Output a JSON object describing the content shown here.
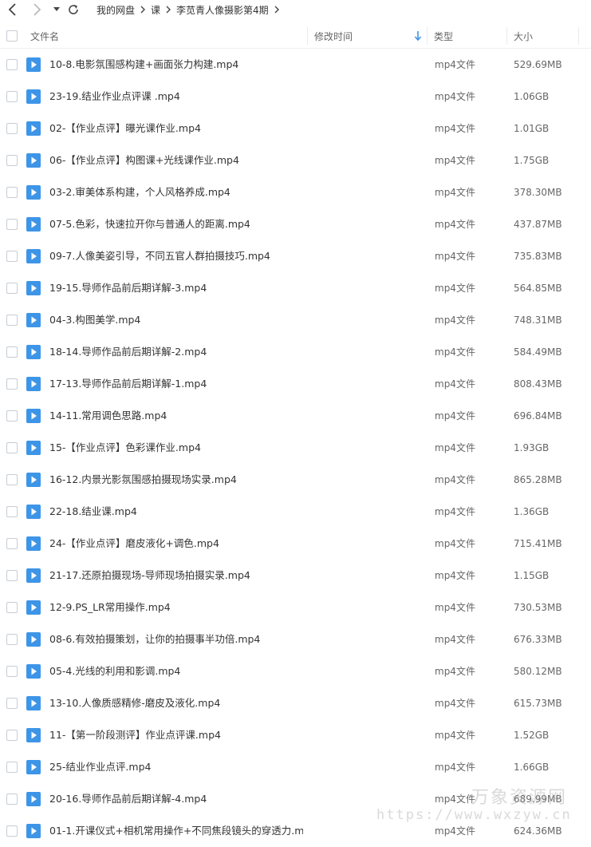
{
  "breadcrumb": [
    "我的网盘",
    "课",
    "李苋青人像摄影第4期"
  ],
  "columns": {
    "name": "文件名",
    "modified": "修改时间",
    "type": "类型",
    "size": "大小"
  },
  "files": [
    {
      "name": "10-8.电影氛围感构建+画面张力构建.mp4",
      "type": "mp4文件",
      "size": "529.69MB"
    },
    {
      "name": "23-19.结业作业点评课 .mp4",
      "type": "mp4文件",
      "size": "1.06GB"
    },
    {
      "name": "02-【作业点评】曝光课作业.mp4",
      "type": "mp4文件",
      "size": "1.01GB"
    },
    {
      "name": "06-【作业点评】构图课+光线课作业.mp4",
      "type": "mp4文件",
      "size": "1.75GB"
    },
    {
      "name": "03-2.审美体系构建，个人风格养成.mp4",
      "type": "mp4文件",
      "size": "378.30MB"
    },
    {
      "name": "07-5.色彩，快速拉开你与普通人的距离.mp4",
      "type": "mp4文件",
      "size": "437.87MB"
    },
    {
      "name": "09-7.人像美姿引导，不同五官人群拍摄技巧.mp4",
      "type": "mp4文件",
      "size": "735.83MB"
    },
    {
      "name": "19-15.导师作品前后期详解-3.mp4",
      "type": "mp4文件",
      "size": "564.85MB"
    },
    {
      "name": "04-3.构图美学.mp4",
      "type": "mp4文件",
      "size": "748.31MB"
    },
    {
      "name": "18-14.导师作品前后期详解-2.mp4",
      "type": "mp4文件",
      "size": "584.49MB"
    },
    {
      "name": "17-13.导师作品前后期详解-1.mp4",
      "type": "mp4文件",
      "size": "808.43MB"
    },
    {
      "name": "14-11.常用调色思路.mp4",
      "type": "mp4文件",
      "size": "696.84MB"
    },
    {
      "name": "15-【作业点评】色彩课作业.mp4",
      "type": "mp4文件",
      "size": "1.93GB"
    },
    {
      "name": "16-12.内景光影氛围感拍摄现场实录.mp4",
      "type": "mp4文件",
      "size": "865.28MB"
    },
    {
      "name": "22-18.结业课.mp4",
      "type": "mp4文件",
      "size": "1.36GB"
    },
    {
      "name": "24-【作业点评】磨皮液化+调色.mp4",
      "type": "mp4文件",
      "size": "715.41MB"
    },
    {
      "name": "21-17.还原拍摄现场-导师现场拍摄实录.mp4",
      "type": "mp4文件",
      "size": "1.15GB"
    },
    {
      "name": "12-9.PS_LR常用操作.mp4",
      "type": "mp4文件",
      "size": "730.53MB"
    },
    {
      "name": "08-6.有效拍摄策划，让你的拍摄事半功倍.mp4",
      "type": "mp4文件",
      "size": "676.33MB"
    },
    {
      "name": "05-4.光线的利用和影调.mp4",
      "type": "mp4文件",
      "size": "580.12MB"
    },
    {
      "name": "13-10.人像质感精修-磨皮及液化.mp4",
      "type": "mp4文件",
      "size": "615.73MB"
    },
    {
      "name": "11-【第一阶段测评】作业点评课.mp4",
      "type": "mp4文件",
      "size": "1.52GB"
    },
    {
      "name": "25-结业作业点评.mp4",
      "type": "mp4文件",
      "size": "1.66GB"
    },
    {
      "name": "20-16.导师作品前后期详解-4.mp4",
      "type": "mp4文件",
      "size": "689.99MB"
    },
    {
      "name": "01-1.开课仪式+相机常用操作+不同焦段镜头的穿透力.m...",
      "type": "mp4文件",
      "size": "624.36MB"
    }
  ],
  "watermark": {
    "brand": "万象资源网",
    "url": "https://www.wxzyw.cn"
  },
  "colors": {
    "file_icon": "#3d95e8",
    "accent": "#3d95e8",
    "text": "#333333",
    "muted": "#666666"
  },
  "icons": {
    "back": "chevron-left-icon",
    "forward": "chevron-right-icon",
    "dropdown": "caret-down-icon",
    "refresh": "refresh-icon",
    "breadcrumb_sep": "chevron-right-icon",
    "sort": "arrow-down-icon",
    "file": "video-file-icon"
  }
}
